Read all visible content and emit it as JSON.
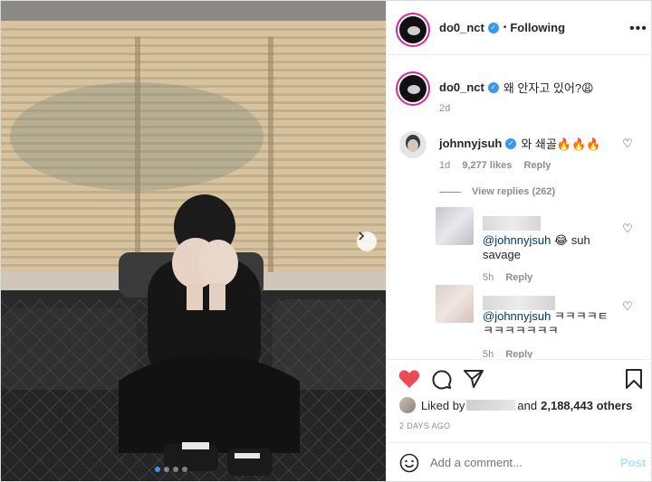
{
  "header": {
    "username": "do0_nct",
    "separator": "•",
    "follow_status": "Following",
    "more_label": "•••"
  },
  "caption": {
    "username": "do0_nct",
    "text": "왜 안자고 있어?😩",
    "time": "2d"
  },
  "comment": {
    "username": "johnnyjsuh",
    "text": "와 쇄골🔥🔥🔥",
    "time": "1d",
    "likes": "9,277 likes",
    "reply_label": "Reply",
    "view_replies": "View replies (262)"
  },
  "replies": [
    {
      "mention": "@johnnyjsuh",
      "text_line1": " 😂 suh",
      "text_line2": "savage",
      "time": "5h",
      "reply_label": "Reply"
    },
    {
      "mention": "@johnnyjsuh",
      "text_line1": " ㅋㅋㅋㅋㅌ",
      "text_line2": "ㅋㅋㅋㅋㅋㅋㅋ",
      "time": "5h",
      "reply_label": "Reply"
    }
  ],
  "likes_line": {
    "prefix": "Liked by",
    "suffix": "and",
    "count": "2,188,443 others"
  },
  "post_time": "2 DAYS AGO",
  "comment_box": {
    "placeholder": "Add a comment...",
    "post_label": "Post"
  },
  "colors": {
    "accent": "#3897f0",
    "like_red": "#ed4956",
    "story_ring": "#d6249f"
  },
  "carousel": {
    "slide_count": 4,
    "active_index": 0
  }
}
